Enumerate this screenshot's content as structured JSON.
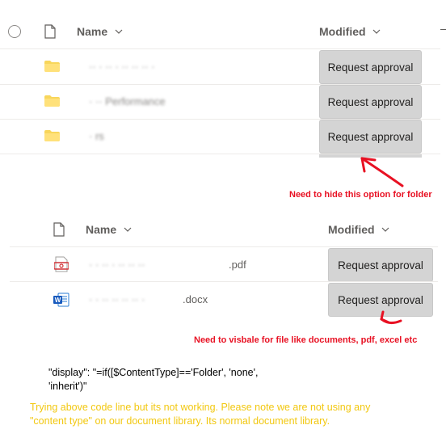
{
  "panel1": {
    "col_name": "Name",
    "col_modified": "Modified",
    "rows": [
      {
        "name": "·· · ·· · ·· ·· ·· ·",
        "action": "Request approval"
      },
      {
        "name": "· ·· Performance",
        "action": "Request approval"
      },
      {
        "name": "· rs",
        "action": "Request approval"
      }
    ]
  },
  "annotation1": "Need to hide this option  for folder",
  "panel2": {
    "col_name": "Name",
    "col_modified": "Modified",
    "rows": [
      {
        "name_hidden": "· · ·· · ·· ·· ··",
        "ext": ".pdf",
        "icon": "pdf-icon",
        "action": "Request approval"
      },
      {
        "name_hidden": "· · ·· ·· ·· ·· ·",
        "ext": ".docx",
        "icon": "word-icon",
        "action": "Request approval"
      }
    ]
  },
  "annotation2": "Need to visbale for file like documents, pdf, excel etc",
  "code": {
    "line1": "\"display\": \"=if([$ContentType]=='Folder', 'none',",
    "line2": "'inherit')\""
  },
  "note": "Trying above code line but its not working. Please note we are not using any \"content type\" on our document library. Its normal document library.",
  "colors": {
    "annotation": "#e81123",
    "note": "#f2c811",
    "button": "#d4d4d4",
    "folder": "#f8d65b"
  }
}
